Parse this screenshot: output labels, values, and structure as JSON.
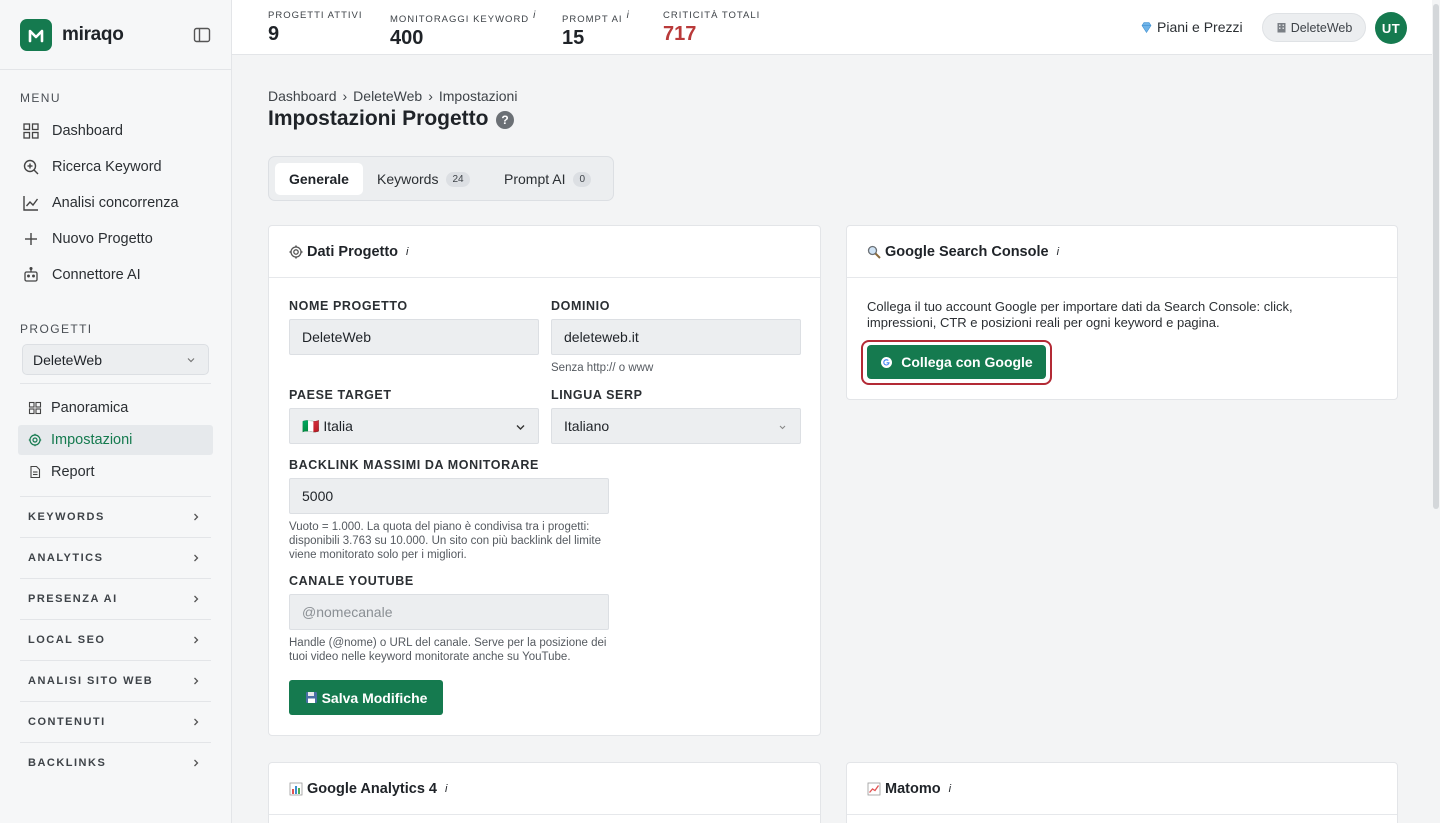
{
  "brand": {
    "name": "miraqo"
  },
  "sidebar": {
    "menu_title": "MENU",
    "menu_items": [
      {
        "label": "Dashboard",
        "icon": "grid-icon"
      },
      {
        "label": "Ricerca Keyword",
        "icon": "search-icon"
      },
      {
        "label": "Analisi concorrenza",
        "icon": "chart-line-icon"
      },
      {
        "label": "Nuovo Progetto",
        "icon": "plus-icon"
      },
      {
        "label": "Connettore AI",
        "icon": "robot-icon"
      }
    ],
    "projects_title": "PROGETTI",
    "project_select": "DeleteWeb",
    "sub_items": [
      {
        "label": "Panoramica",
        "icon": "grid-small-icon"
      },
      {
        "label": "Impostazioni",
        "icon": "gear-icon",
        "active": true
      },
      {
        "label": "Report",
        "icon": "document-icon"
      }
    ],
    "groups": [
      "KEYWORDS",
      "ANALYTICS",
      "PRESENZA AI",
      "LOCAL SEO",
      "ANALISI SITO WEB",
      "CONTENUTI",
      "BACKLINKS"
    ]
  },
  "topbar": {
    "stats": [
      {
        "label": "PROGETTI ATTIVI",
        "value": "9",
        "info": ""
      },
      {
        "label": "MONITORAGGI KEYWORD",
        "value": "400",
        "info": "i"
      },
      {
        "label": "PROMPT AI",
        "value": "15",
        "info": "i"
      },
      {
        "label": "CRITICITÀ TOTALI",
        "value": "717",
        "info": "",
        "color": "#b93a3a"
      }
    ],
    "plans_label": "Piani e Prezzi",
    "project_chip": "DeleteWeb",
    "avatar": "UT"
  },
  "breadcrumb": [
    "Dashboard",
    "DeleteWeb",
    "Impostazioni"
  ],
  "page_title": "Impostazioni Progetto",
  "tabs": [
    {
      "label": "Generale",
      "badge": ""
    },
    {
      "label": "Keywords",
      "badge": "24"
    },
    {
      "label": "Prompt AI",
      "badge": "0"
    }
  ],
  "dati_progetto": {
    "title": "Dati Progetto",
    "info": "i",
    "nome_label": "NOME PROGETTO",
    "nome_value": "DeleteWeb",
    "dominio_label": "DOMINIO",
    "dominio_value": "deleteweb.it",
    "dominio_hint": "Senza http:// o www",
    "paese_label": "PAESE TARGET",
    "paese_value": "🇮🇹 Italia",
    "lingua_label": "LINGUA SERP",
    "lingua_value": "Italiano",
    "backlink_label": "BACKLINK MASSIMI DA MONITORARE",
    "backlink_value": "5000",
    "backlink_hint": "Vuoto = 1.000. La quota del piano è condivisa tra i progetti: disponibili 3.763 su 10.000. Un sito con più backlink del limite viene monitorato solo per i migliori.",
    "youtube_label": "CANALE YOUTUBE",
    "youtube_placeholder": "@nomecanale",
    "youtube_hint": "Handle (@nome) o URL del canale. Serve per la posizione dei tuoi video nelle keyword monitorate anche su YouTube.",
    "save_label": "Salva Modifiche"
  },
  "gsc": {
    "title": "Google Search Console",
    "info": "i",
    "description": "Collega il tuo account Google per importare dati da Search Console: click, impressioni, CTR e posizioni reali per ogni keyword e pagina.",
    "button_label": "Collega con Google"
  },
  "ga4": {
    "title": "Google Analytics 4",
    "info": "i"
  },
  "matomo": {
    "title": "Matomo",
    "info": "i"
  },
  "colors": {
    "accent": "#157a4f",
    "danger": "#b93a3a",
    "highlight": "#b32a35"
  }
}
